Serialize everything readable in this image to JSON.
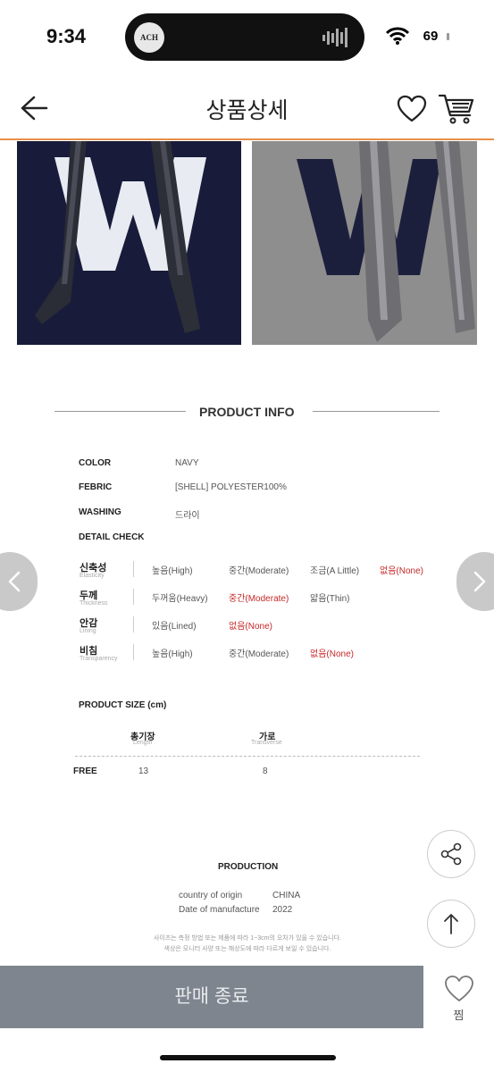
{
  "status_bar": {
    "time": "9:34",
    "battery": "69",
    "island_art_text": "ACH"
  },
  "header": {
    "title": "상품상세"
  },
  "product_info": {
    "title": "PRODUCT INFO",
    "rows": [
      {
        "label": "COLOR",
        "value": "NAVY"
      },
      {
        "label": "FEBRIC",
        "value": "[SHELL] POLYESTER100%"
      },
      {
        "label": "WASHING",
        "value": "드라이"
      }
    ],
    "detail_check": {
      "title": "DETAIL CHECK",
      "rows": [
        {
          "kr": "신축성",
          "en": "Elasticity",
          "options": [
            "높음(High)",
            "중간(Moderate)",
            "조금(A Little)",
            "없음(None)"
          ],
          "selected": 3
        },
        {
          "kr": "두께",
          "en": "Thickness",
          "options": [
            "두꺼움(Heavy)",
            "중간(Moderate)",
            "얇음(Thin)"
          ],
          "selected": 1
        },
        {
          "kr": "안감",
          "en": "Lining",
          "options": [
            "있음(Lined)",
            "없음(None)"
          ],
          "selected": 1
        },
        {
          "kr": "비침",
          "en": "Transparency",
          "options": [
            "높음(High)",
            "중간(Moderate)",
            "없음(None)"
          ],
          "selected": 2
        }
      ]
    }
  },
  "product_size": {
    "title": "PRODUCT SIZE (cm)",
    "columns": [
      {
        "kr": "총기장",
        "en": "Length"
      },
      {
        "kr": "가로",
        "en": "Transverse"
      }
    ],
    "rows": [
      {
        "size": "FREE",
        "values": [
          "13",
          "8"
        ]
      }
    ]
  },
  "production": {
    "title": "PRODUCTION",
    "rows": [
      {
        "label": "country of origin",
        "value": "CHINA"
      },
      {
        "label": "Date of manufacture",
        "value": "2022"
      }
    ],
    "notes": [
      "사이즈는 측정 방법 또는 제품에 따라 1~3cm의 오차가 있을 수 있습니다.",
      "색상은 모니터 사양 또는 해상도에 따라 다르게 보일 수 있습니다."
    ]
  },
  "bottom_bar": {
    "sold_out_label": "판매 종료",
    "like_label": "찜"
  },
  "colors": {
    "accent_line": "#e8904a",
    "selected_option": "#c62828",
    "navy": "#181c3a",
    "buy_bar": "#7e858e"
  }
}
